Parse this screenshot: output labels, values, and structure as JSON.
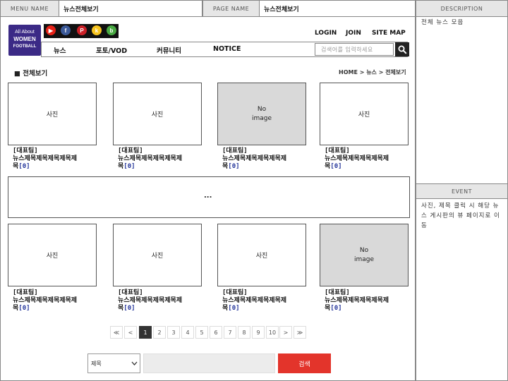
{
  "header": {
    "menu_name_label": "MENU NAME",
    "menu_name_value": "뉴스전체보기",
    "page_name_label": "PAGE NAME",
    "page_name_value": "뉴스전체보기"
  },
  "right_panel": {
    "description_label": "DESCRIPTION",
    "description_text": "전체 뉴스 모음",
    "event_label": "EVENT",
    "event_text": "사진, 제목 클릭 시 해당 뉴스 게시판의 뷰 페이지로 이동"
  },
  "logo": {
    "lines": [
      "All About",
      "WOMEN",
      "FOOTBALL"
    ],
    "bg_color": "#3b2a86"
  },
  "sns": [
    {
      "name": "youtube-icon",
      "glyph": "▶",
      "color": "#e62117"
    },
    {
      "name": "facebook-icon",
      "glyph": "f",
      "color": "#3b5998"
    },
    {
      "name": "pinterest-icon",
      "glyph": "P",
      "color": "#cb2027"
    },
    {
      "name": "kakao-icon",
      "glyph": "k",
      "color": "#f7c41f"
    },
    {
      "name": "blog-icon",
      "glyph": "b",
      "color": "#49a942"
    }
  ],
  "util": {
    "login": "LOGIN",
    "join": "JOIN",
    "sitemap": "SITE MAP"
  },
  "nav": {
    "items": [
      "뉴스",
      "포토/VOD",
      "커뮤니티",
      "NOTICE"
    ]
  },
  "search": {
    "placeholder": "검색어를 입력하세요"
  },
  "section": {
    "title": "■ 전체보기",
    "breadcrumb": "HOME > 뉴스 > 전체보기"
  },
  "cards_top": [
    {
      "image_label": "사진",
      "no_image": false,
      "tag": "[대표팀]",
      "line1": "뉴스제목제목제목제목제",
      "line2": "목",
      "count": "[0]"
    },
    {
      "image_label": "사진",
      "no_image": false,
      "tag": "[대표팀]",
      "line1": "뉴스제목제목제목제목제",
      "line2": "목",
      "count": "[0]"
    },
    {
      "image_label": "No\nimage",
      "no_image": true,
      "tag": "[대표팀]",
      "line1": "뉴스제목제목제목제목제",
      "line2": "목",
      "count": "[0]"
    },
    {
      "image_label": "사진",
      "no_image": false,
      "tag": "[대표팀]",
      "line1": "뉴스제목제목제목제목제",
      "line2": "목",
      "count": "[0]"
    }
  ],
  "ellipsis": "...",
  "cards_bottom": [
    {
      "image_label": "사진",
      "no_image": false,
      "tag": "[대표팀]",
      "line1": "뉴스제목제목제목제목제",
      "line2": "목",
      "count": "[0]"
    },
    {
      "image_label": "사진",
      "no_image": false,
      "tag": "[대표팀]",
      "line1": "뉴스제목제목제목제목제",
      "line2": "목",
      "count": "[0]"
    },
    {
      "image_label": "사진",
      "no_image": false,
      "tag": "[대표팀]",
      "line1": "뉴스제목제목제목제목제",
      "line2": "목",
      "count": "[0]"
    },
    {
      "image_label": "No\nimage",
      "no_image": true,
      "tag": "[대표팀]",
      "line1": "뉴스제목제목제목제목제",
      "line2": "목",
      "count": "[0]"
    }
  ],
  "pagination": {
    "first": "≪",
    "prev": "<",
    "pages": [
      "1",
      "2",
      "3",
      "4",
      "5",
      "6",
      "7",
      "8",
      "9",
      "10"
    ],
    "current": "1",
    "next": ">",
    "last": "≫"
  },
  "bottom_search": {
    "select_value": "제목",
    "button_label": "검색"
  }
}
